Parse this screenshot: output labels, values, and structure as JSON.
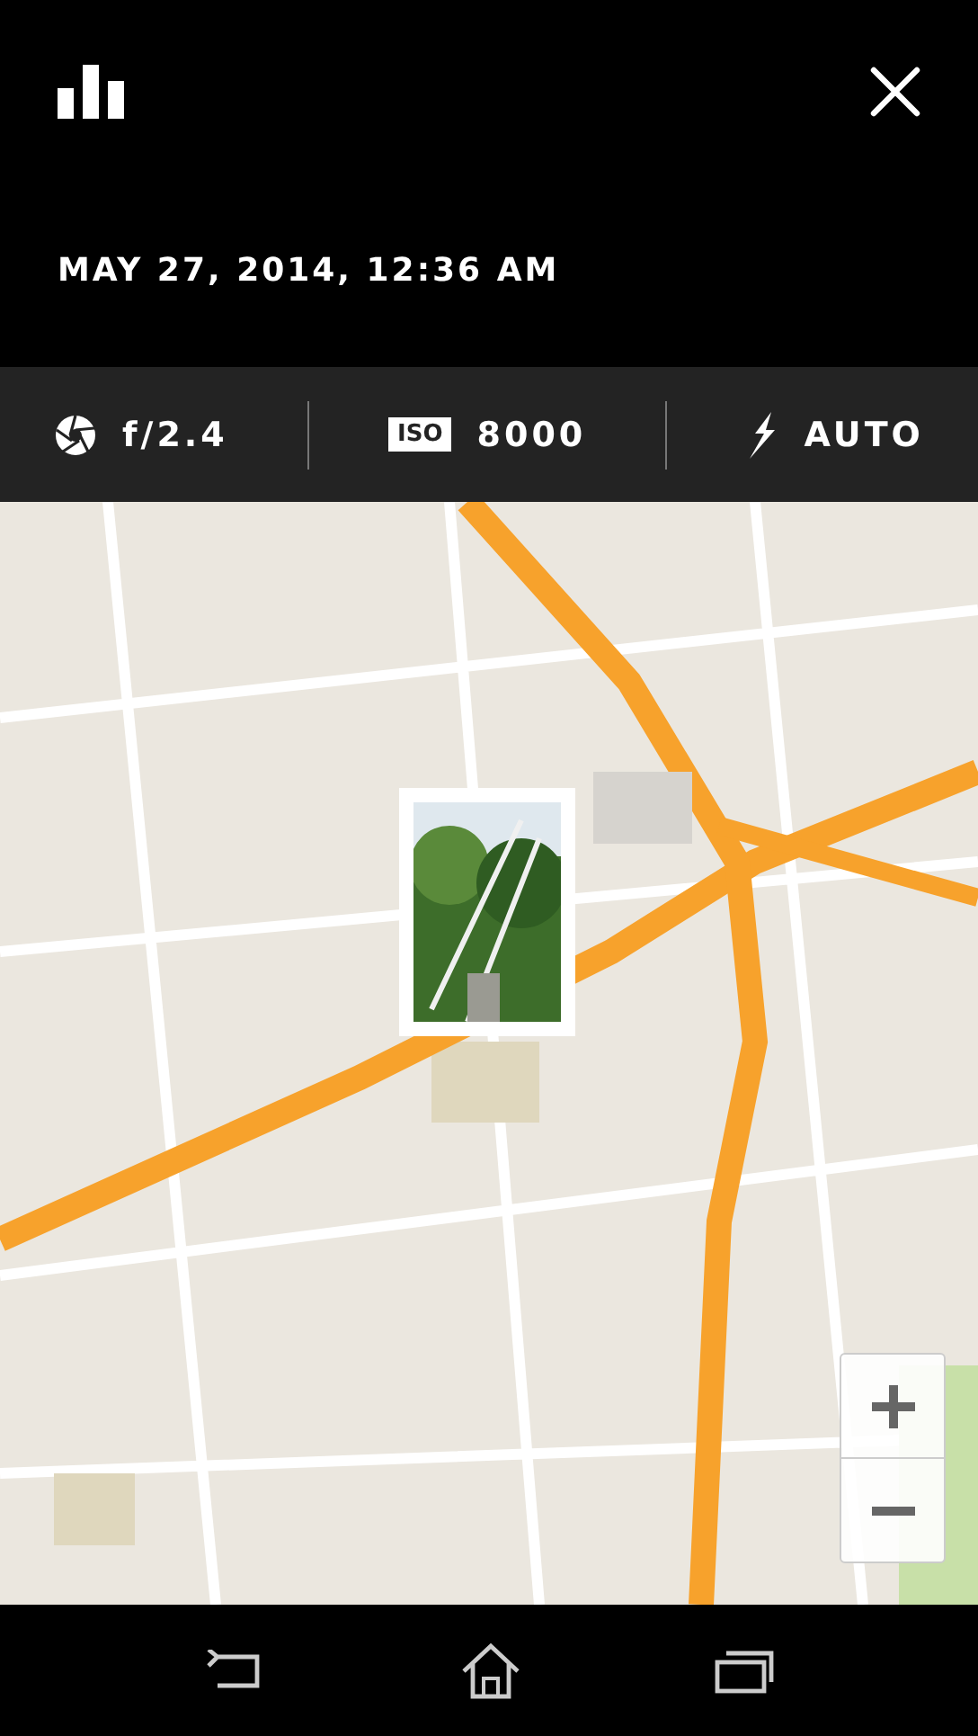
{
  "header": {
    "date": "MAY 27, 2014, 12:36 AM"
  },
  "exif": [
    {
      "kind": "aperture",
      "value": "f/2.4"
    },
    {
      "kind": "iso",
      "badge": "ISO",
      "value": "8000"
    },
    {
      "kind": "flash",
      "value": "AUTO"
    }
  ]
}
